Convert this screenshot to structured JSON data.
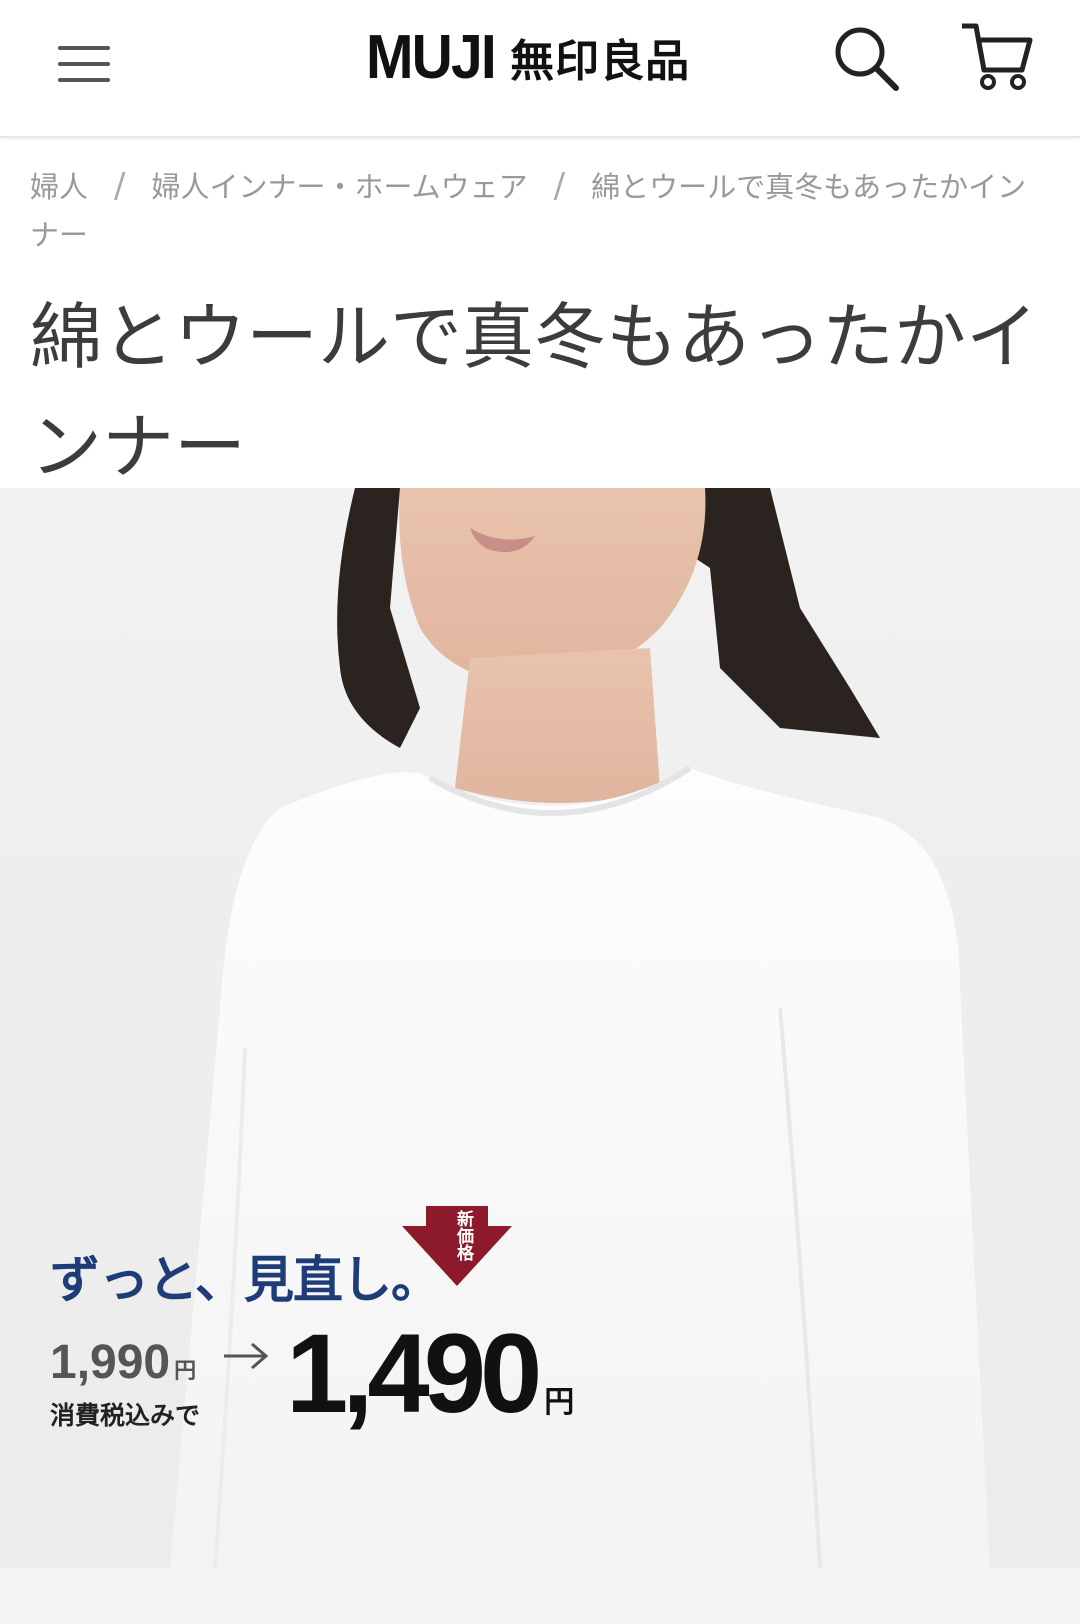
{
  "header": {
    "logo_en": "MUJI",
    "logo_jp": "無印良品",
    "menu_icon": "hamburger-menu-icon",
    "search_icon": "search-icon",
    "cart_icon": "cart-icon"
  },
  "breadcrumb": {
    "items": [
      {
        "label": "婦人"
      },
      {
        "label": "婦人インナー・ホームウェア"
      },
      {
        "label": "綿とウールで真冬もあったかインナー"
      }
    ],
    "separator": "/"
  },
  "page": {
    "title": "綿とウールで真冬もあったかインナー"
  },
  "promo": {
    "tagline": "ずっと、見直し。",
    "badge_text": "新価格",
    "old_price": "1,990",
    "old_price_unit": "円",
    "tax_note": "消費税込みで",
    "new_price": "1,490",
    "new_price_unit": "円"
  },
  "colors": {
    "tagline_blue": "#1e3c78",
    "badge_red": "#8c1a2a",
    "text_dark": "#111111",
    "breadcrumb_gray": "#999999"
  }
}
